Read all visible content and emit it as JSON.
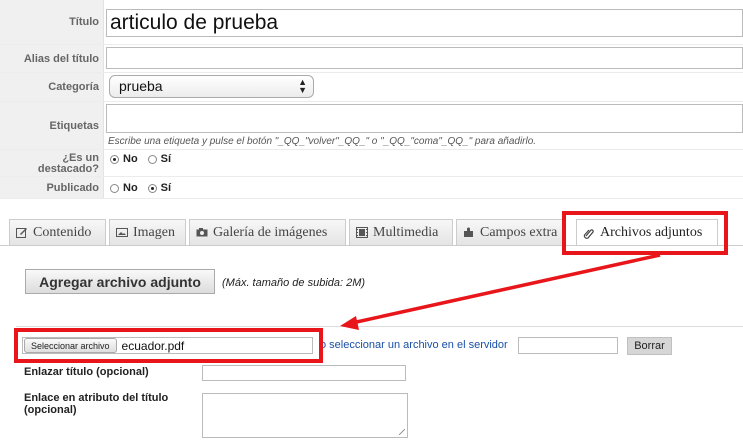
{
  "form": {
    "title_label": "Título",
    "title_value": "articulo de prueba",
    "alias_label": "Alias del título",
    "category_label": "Categoría",
    "category_value": "prueba",
    "tags_label": "Etiquetas",
    "tags_help": "Escribe una etiqueta y pulse el botón \"_QQ_\"volver\"_QQ_\" o \"_QQ_\"coma\"_QQ_\" para añadirlo.",
    "featured_label": "¿Es un destacado?",
    "featured_no": "No",
    "featured_yes": "Sí",
    "featured_selected": "No",
    "published_label": "Publicado",
    "published_no": "No",
    "published_yes": "Sí",
    "published_selected": "Sí"
  },
  "tabs": [
    {
      "label": "Contenido",
      "icon": "edit-icon",
      "active": false
    },
    {
      "label": "Imagen",
      "icon": "image-icon",
      "active": false
    },
    {
      "label": "Galería de imágenes",
      "icon": "camera-icon",
      "active": false
    },
    {
      "label": "Multimedia",
      "icon": "film-icon",
      "active": false
    },
    {
      "label": "Campos extra",
      "icon": "puzzle-icon",
      "active": false
    },
    {
      "label": "Archivos adjuntos",
      "icon": "paperclip-icon",
      "active": true
    }
  ],
  "attachments": {
    "add_button": "Agregar archivo adjunto",
    "max_size_note": "(Máx. tamaño de subida: 2M)",
    "file_button": "Seleccionar archivo",
    "file_name": "ecuador.pdf",
    "server_link": "o seleccionar un archivo en el servidor",
    "delete_button": "Borrar",
    "link_title_label": "Enlazar título (opcional)",
    "title_attr_label": "Enlace en atributo del título (opcional)"
  },
  "colors": {
    "highlight": "#e8161b",
    "link": "#1a4fa6",
    "label_bg": "#f0f0f0"
  }
}
